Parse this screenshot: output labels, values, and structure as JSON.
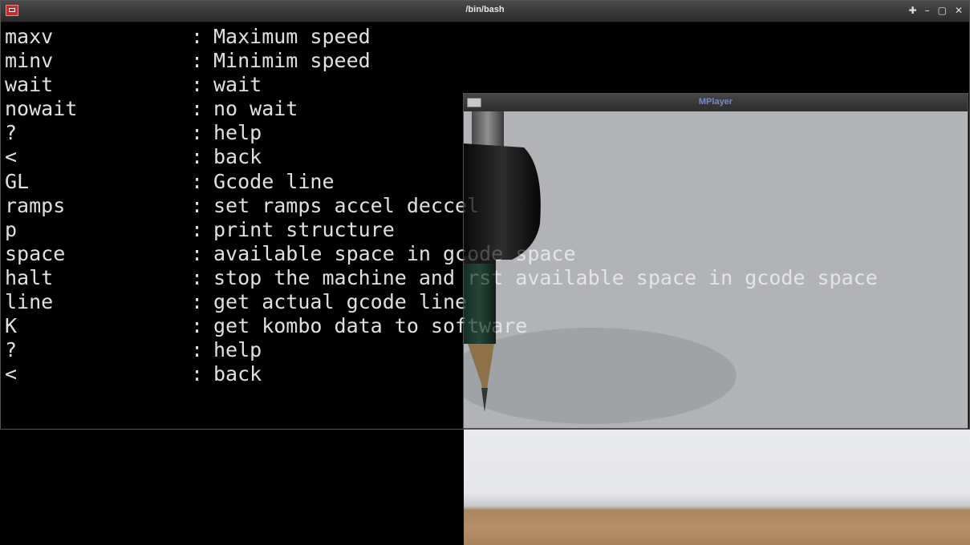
{
  "terminal": {
    "title": "/bin/bash",
    "controls": [
      "✚",
      "–",
      "▢",
      "✕"
    ],
    "lines": [
      {
        "cmd": "maxv",
        "sep": ":",
        "desc": "Maximum speed"
      },
      {
        "cmd": "minv",
        "sep": ":",
        "desc": "Minimim speed"
      },
      {
        "cmd": "wait",
        "sep": ":",
        "desc": "wait"
      },
      {
        "cmd": "nowait",
        "sep": ":",
        "desc": "no wait"
      },
      {
        "cmd": "?",
        "sep": ":",
        "desc": "help"
      },
      {
        "cmd": "<",
        "sep": ":",
        "desc": "back"
      },
      {
        "cmd": "GL",
        "sep": ":",
        "desc": "Gcode line"
      },
      {
        "cmd": "ramps",
        "sep": ":",
        "desc": "set ramps accel deccel"
      },
      {
        "cmd": "p",
        "sep": ":",
        "desc": "print structure"
      },
      {
        "cmd": "space",
        "sep": ":",
        "desc": "available space in gcode space"
      },
      {
        "cmd": "halt",
        "sep": ":",
        "desc": "stop the machine and rst available space in gcode space"
      },
      {
        "cmd": "line",
        "sep": ":",
        "desc": "get actual gcode line"
      },
      {
        "cmd": "K",
        "sep": ":",
        "desc": "get kombo data to software"
      },
      {
        "cmd": "?",
        "sep": ":",
        "desc": "help"
      },
      {
        "cmd": "<",
        "sep": ":",
        "desc": "back"
      }
    ]
  },
  "mplayer": {
    "title": "MPlayer"
  },
  "colors": {
    "terminal_bg": "#000000",
    "terminal_fg": "#e0e0e0",
    "mplayer_title": "#9db0ff"
  }
}
